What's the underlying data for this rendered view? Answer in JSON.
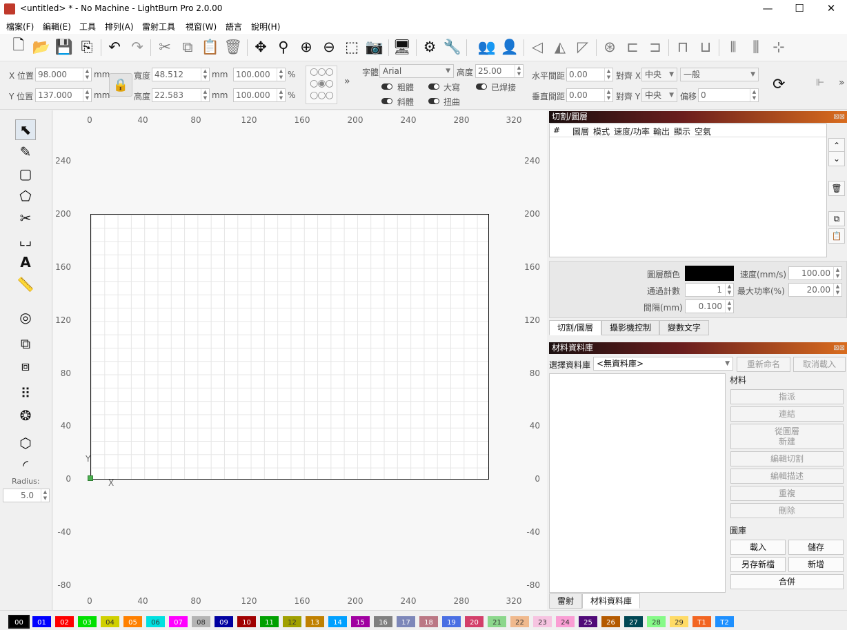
{
  "window": {
    "title": "<untitled> * - No Machine - LightBurn Pro 2.0.00",
    "minimize": "—",
    "maximize": "☐",
    "close": "✕"
  },
  "menu": [
    "檔案(F)",
    "編輯(E)",
    "工具",
    "排列(A)",
    "雷射工具",
    "視窗(W)",
    "語言",
    "說明(H)"
  ],
  "props": {
    "x_label": "X 位置",
    "x_value": "98.000",
    "y_label": "Y 位置",
    "y_value": "137.000",
    "unit": "mm",
    "width_label": "寬度",
    "width_value": "48.512",
    "height_label": "高度",
    "height_value": "22.583",
    "scale_w": "100.000",
    "scale_h": "100.000",
    "pct": "%",
    "font_label": "字體",
    "font_value": "Arial",
    "font_height_label": "高度",
    "font_height_value": "25.00",
    "bold": "粗體",
    "italic": "斜體",
    "upper": "大寫",
    "distort": "扭曲",
    "welded": "已焊接",
    "hspace_label": "水平間距",
    "hspace_value": "0.00",
    "vspace_label": "垂直間距",
    "vspace_value": "0.00",
    "align_x_label": "對齊 X",
    "align_x_value": "中央",
    "align_y_label": "對齊 Y",
    "align_y_value": "中央",
    "mode_value": "一般",
    "offset_label": "偏移",
    "offset_value": "0",
    "more": "»"
  },
  "lefttools": {
    "radius_label": "Radius:",
    "radius_value": "5.0"
  },
  "ruler": {
    "top": [
      "0",
      "40",
      "80",
      "120",
      "160",
      "200",
      "240",
      "280",
      "320"
    ],
    "bottom": [
      "0",
      "40",
      "80",
      "120",
      "160",
      "200",
      "240",
      "280",
      "320"
    ],
    "left": [
      "240",
      "200",
      "160",
      "120",
      "80",
      "40",
      "0",
      "-40",
      "-80"
    ],
    "right": [
      "240",
      "200",
      "160",
      "120",
      "80",
      "40",
      "0",
      "-40",
      "-80"
    ],
    "axis_x": "X",
    "axis_y": "Y"
  },
  "cut_panel": {
    "title": "切割/圖層",
    "columns": [
      "#",
      "圖層",
      "模式",
      "速度/功率",
      "輸出",
      "顯示",
      "空氣"
    ],
    "layer_color_label": "圖層顏色",
    "speed_label": "速度(mm/s)",
    "speed_value": "100.00",
    "passes_label": "通過計數",
    "passes_value": "1",
    "max_power_label": "最大功率(%)",
    "max_power_value": "20.00",
    "interval_label": "間隔(mm)",
    "interval_value": "0.100",
    "tabs": [
      "切割/圖層",
      "攝影機控制",
      "變數文字"
    ]
  },
  "material_panel": {
    "title": "材料資料庫",
    "select_label": "選擇資料庫",
    "select_value": "<無資料庫>",
    "rename": "重新命名",
    "unload": "取消載入",
    "material_label": "材料",
    "assign": "指派",
    "link": "連結",
    "from_layer_1": "從圖層",
    "from_layer_2": "新建",
    "edit_cut": "編輯切割",
    "edit_desc": "編輯描述",
    "duplicate": "重複",
    "delete": "刪除",
    "library_label": "圖庫",
    "load": "載入",
    "save": "儲存",
    "save_as": "另存新檔",
    "new": "新增",
    "merge": "合併",
    "tabs": [
      "雷射",
      "材料資料庫"
    ]
  },
  "palette": [
    {
      "label": "00",
      "color": "#000000"
    },
    {
      "label": "01",
      "color": "#0000ff"
    },
    {
      "label": "02",
      "color": "#ff0000"
    },
    {
      "label": "03",
      "color": "#00e000"
    },
    {
      "label": "04",
      "color": "#d0d000"
    },
    {
      "label": "05",
      "color": "#ff8000"
    },
    {
      "label": "06",
      "color": "#00e0e0"
    },
    {
      "label": "07",
      "color": "#ff00ff"
    },
    {
      "label": "08",
      "color": "#b4b4b4"
    },
    {
      "label": "09",
      "color": "#0000a0"
    },
    {
      "label": "10",
      "color": "#a00000"
    },
    {
      "label": "11",
      "color": "#00a000"
    },
    {
      "label": "12",
      "color": "#a0a000"
    },
    {
      "label": "13",
      "color": "#c08000"
    },
    {
      "label": "14",
      "color": "#00a0ff"
    },
    {
      "label": "15",
      "color": "#a000a0"
    },
    {
      "label": "16",
      "color": "#808080"
    },
    {
      "label": "17",
      "color": "#7d87b9"
    },
    {
      "label": "18",
      "color": "#bb7784"
    },
    {
      "label": "19",
      "color": "#4a6fe3"
    },
    {
      "label": "20",
      "color": "#d33f6a"
    },
    {
      "label": "21",
      "color": "#8cd78c"
    },
    {
      "label": "22",
      "color": "#f0b98d"
    },
    {
      "label": "23",
      "color": "#f6c4e1"
    },
    {
      "label": "24",
      "color": "#fa9ed4"
    },
    {
      "label": "25",
      "color": "#500a78"
    },
    {
      "label": "26",
      "color": "#b45a00"
    },
    {
      "label": "27",
      "color": "#004754"
    },
    {
      "label": "28",
      "color": "#86fa88"
    },
    {
      "label": "29",
      "color": "#ffdb66"
    },
    {
      "label": "T1",
      "color": "#f26522"
    },
    {
      "label": "T2",
      "color": "#1e90ff"
    }
  ]
}
